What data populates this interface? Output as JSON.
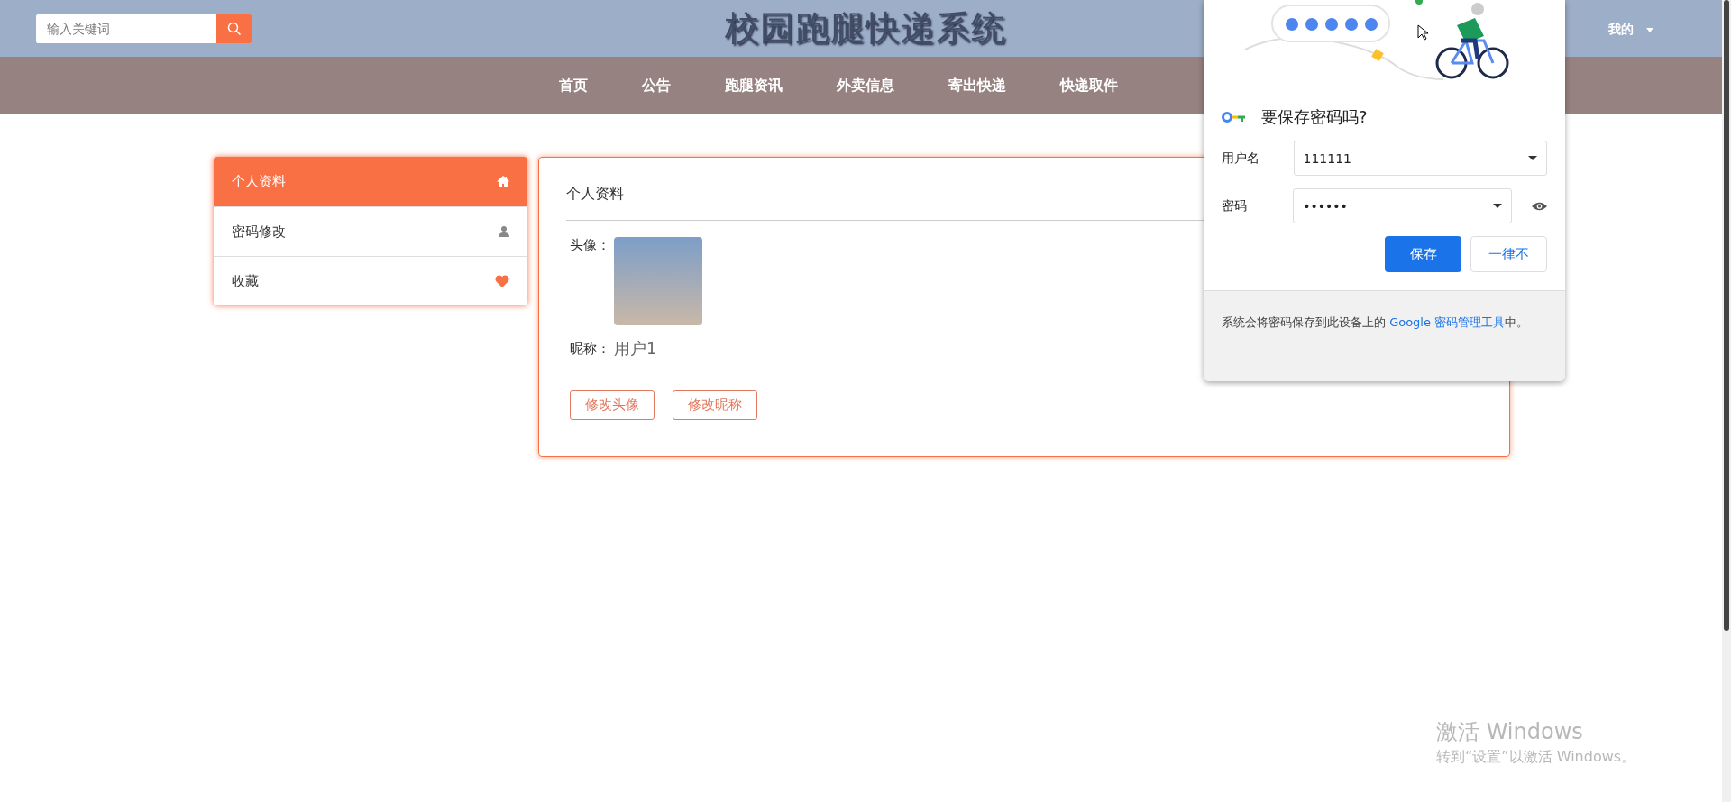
{
  "header": {
    "search": {
      "placeholder": "输入关键词"
    },
    "title": "校园跑腿快递系统",
    "user_menu": "我的"
  },
  "nav": [
    {
      "label": "首页"
    },
    {
      "label": "公告"
    },
    {
      "label": "跑腿资讯"
    },
    {
      "label": "外卖信息"
    },
    {
      "label": "寄出快递"
    },
    {
      "label": "快递取件"
    }
  ],
  "sidebar": {
    "items": [
      {
        "label": "个人资料",
        "kind": "home",
        "selected": true
      },
      {
        "label": "密码修改",
        "kind": "person",
        "selected": false
      },
      {
        "label": "收藏",
        "kind": "heart",
        "selected": false
      }
    ]
  },
  "profile": {
    "title": "个人资料",
    "avatar_label": "头像：",
    "nickname_label": "昵称：",
    "nickname": "用户1",
    "buttons": [
      "修改头像",
      "修改昵称"
    ]
  },
  "password_popup": {
    "title": "要保存密码吗?",
    "username_label": "用户名",
    "username": "111111",
    "password_label": "密码",
    "password": "••••••",
    "save": "保存",
    "never": "一律不",
    "note_prefix": "系统会将密码保存到此设备上的 ",
    "note_link": "Google 密码管理工具",
    "note_suffix": "中。"
  },
  "watermark": {
    "title": "激活 Windows",
    "subtitle": "转到“设置”以激活 Windows。"
  }
}
